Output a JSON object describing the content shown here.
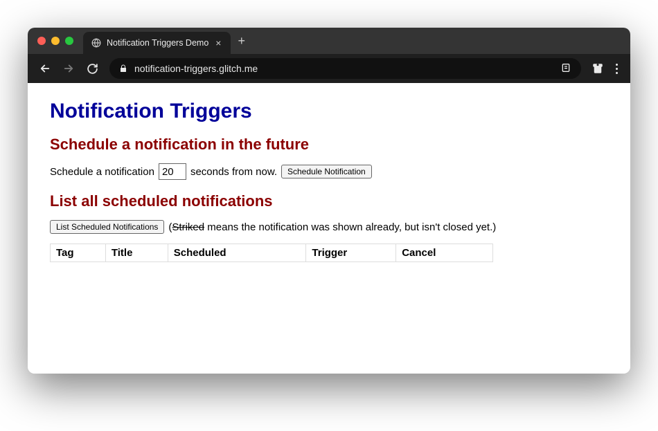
{
  "browser": {
    "tab_title": "Notification Triggers Demo",
    "url": "notification-triggers.glitch.me"
  },
  "page": {
    "title": "Notification Triggers",
    "section_schedule": {
      "heading": "Schedule a notification in the future",
      "prefix": "Schedule a notification",
      "seconds_value": "20",
      "suffix": "seconds from now.",
      "button": "Schedule Notification"
    },
    "section_list": {
      "heading": "List all scheduled notifications",
      "button": "List Scheduled Notifications",
      "note_prefix": "(",
      "note_striked": "Striked",
      "note_rest": " means the notification was shown already, but isn't closed yet.)"
    },
    "table": {
      "headers": {
        "tag": "Tag",
        "title": "Title",
        "scheduled": "Scheduled",
        "trigger": "Trigger",
        "cancel": "Cancel"
      }
    }
  }
}
